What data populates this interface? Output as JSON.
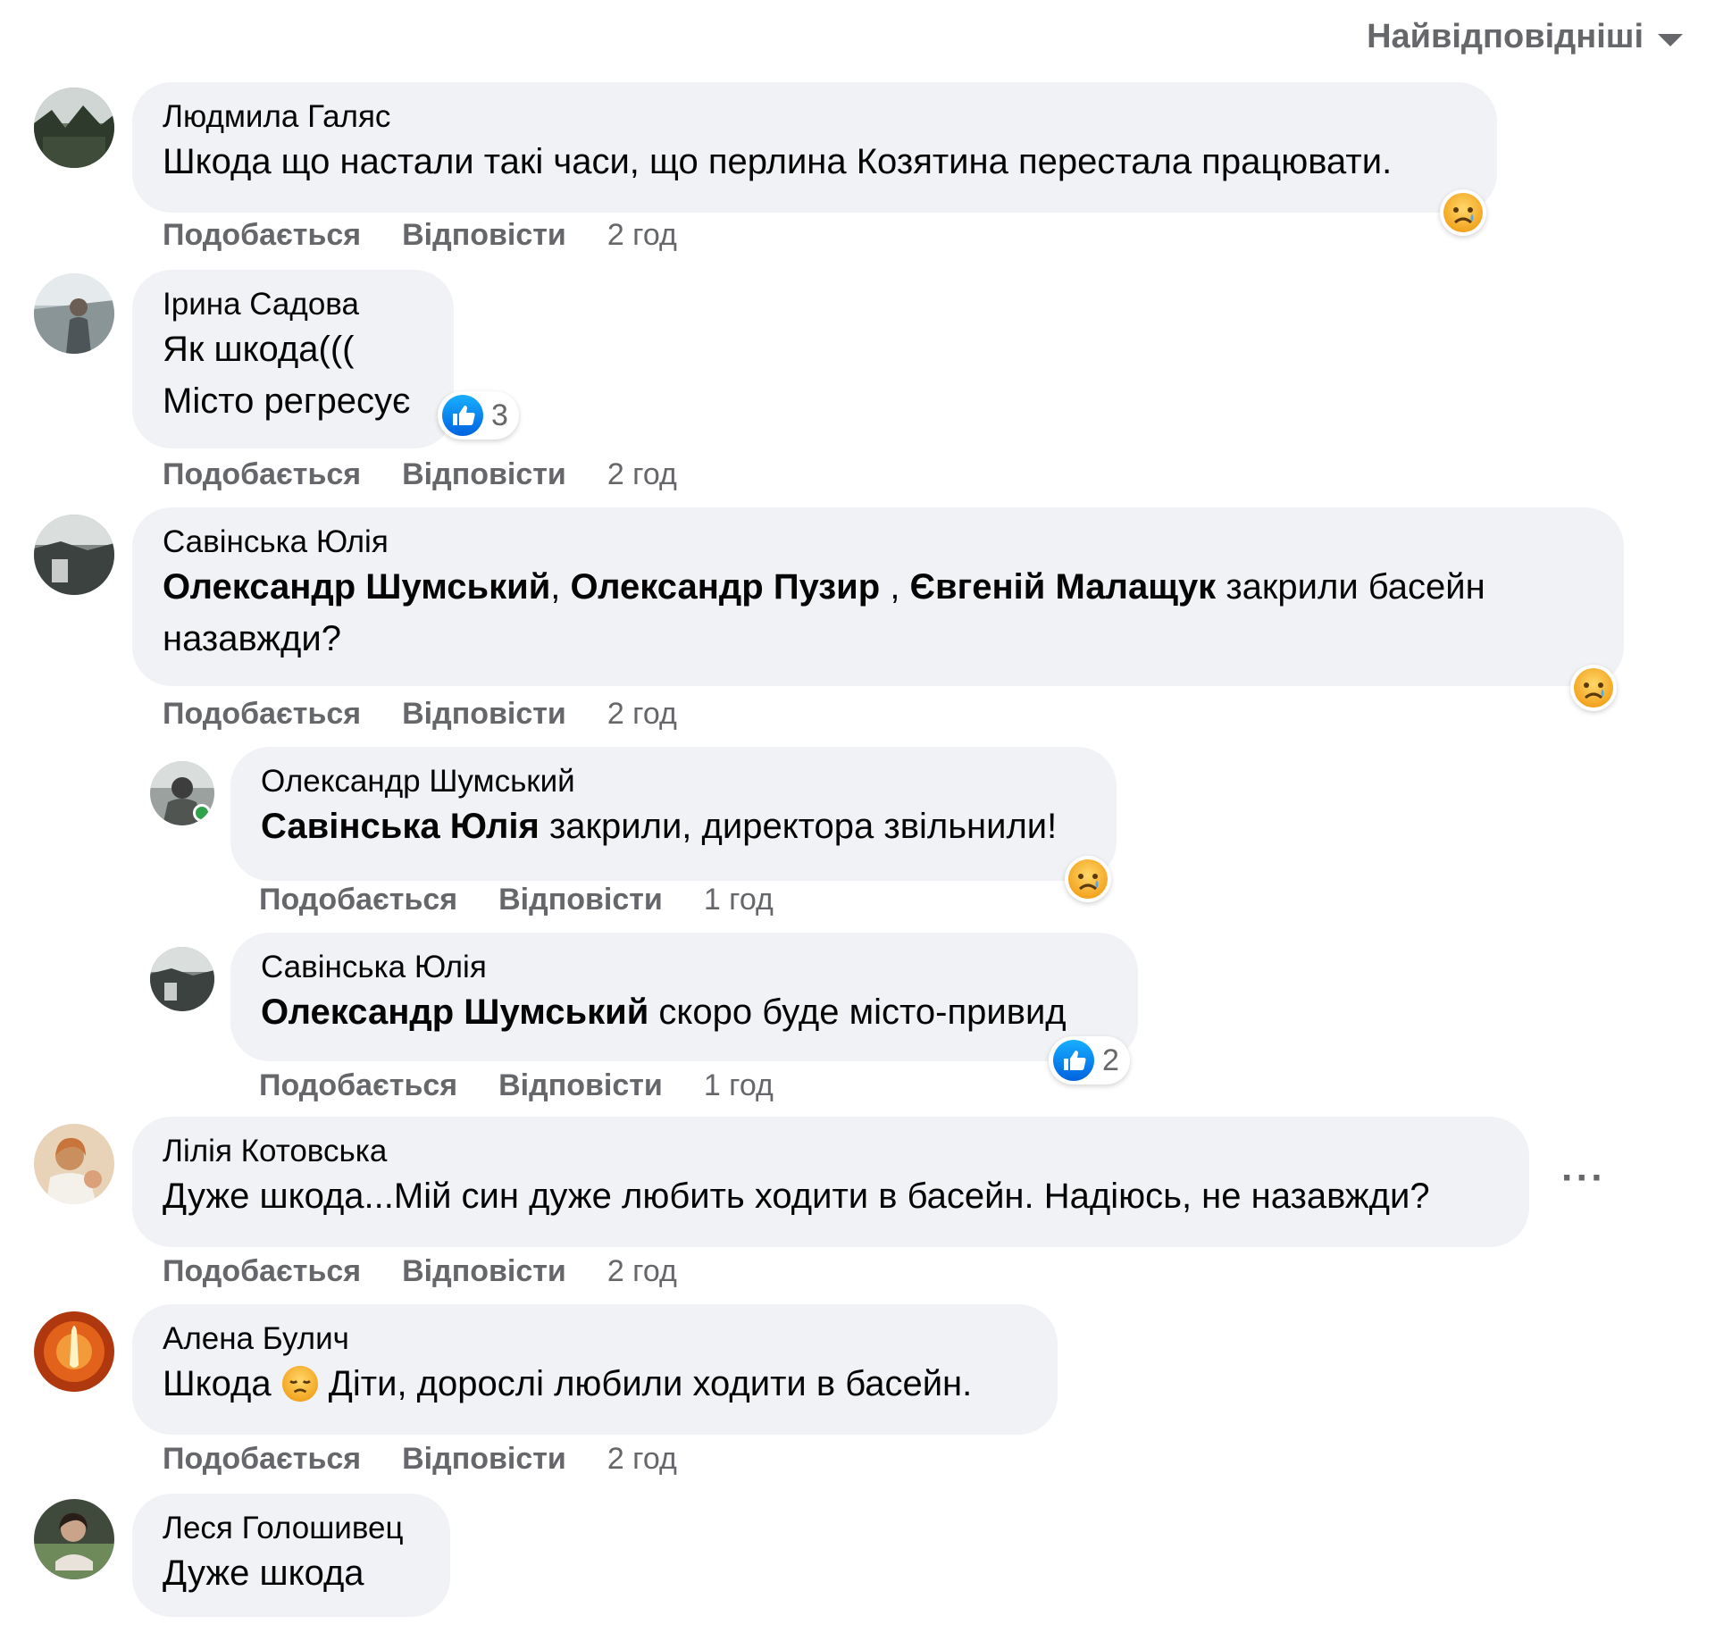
{
  "sort_label": "Найвідповідніші",
  "action_like": "Подобається",
  "action_reply": "Відповісти",
  "comments": [
    {
      "author": "Людмила Галяс",
      "text": "Шкода що настали такі часи, що перлина Козятина перестала працювати.",
      "time": "2 год",
      "reaction": "sad-icon"
    },
    {
      "author": "Ірина Садова",
      "line1": "Як шкода(((",
      "line2": "Місто регресує",
      "time": "2 год",
      "reaction": "like-icon",
      "reaction_count": "3"
    },
    {
      "author": "Савінська Юлія",
      "mention1": "Олександр Шумський",
      "sep1": ", ",
      "mention2": "Олександр Пузир",
      "sep2": " , ",
      "mention3": "Євгеній Малащук",
      "text_after": " закрили басейн",
      "line2": "назавжди?",
      "time": "2 год",
      "reaction": "sad-icon"
    },
    {
      "author": "Олександр Шумський",
      "mention": "Савінська Юлія",
      "text": " закрили, директора звільнили!",
      "time": "1 год",
      "reaction": "sad-icon"
    },
    {
      "author": "Савінська Юлія",
      "mention": "Олександр Шумський",
      "text": " скоро буде місто-привид",
      "time": "1 год",
      "reaction": "like-icon",
      "reaction_count": "2"
    },
    {
      "author": "Лілія Котовська",
      "text": "Дуже шкода...Мій син дуже любить ходити в басейн. Надіюсь, не назавжди?",
      "time": "2 год",
      "more": "···"
    },
    {
      "author": "Алена Булич",
      "text1": "Шкода ",
      "emoji": "disappointed-face-icon",
      "text2": " Діти, дорослі любили ходити в басейн.",
      "time": "2 год"
    },
    {
      "author": "Леся Голошивец",
      "text": "Дуже шкода"
    }
  ]
}
